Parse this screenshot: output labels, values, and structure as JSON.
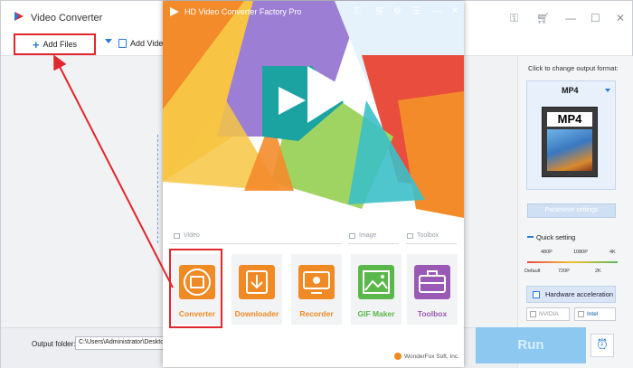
{
  "background_window": {
    "title": "Video Converter",
    "toolbar": {
      "add_files_label": "Add Files",
      "add_video_label": "Add Video"
    },
    "output_folder_label": "Output folder:",
    "output_folder_value": "C:\\Users\\Administrator\\Desktop",
    "right_panel": {
      "format_hint": "Click to change output format:",
      "format_name": "MP4",
      "format_icon_label": "MP4",
      "parameter_settings_label": "Parameter settings",
      "quick_setting_label": "Quick setting",
      "quality_ticks_top": [
        "480P",
        "1080P",
        "4K"
      ],
      "quality_ticks_bottom": [
        "Default",
        "720P",
        "2K"
      ],
      "hardware_acceleration_label": "Hardware acceleration",
      "gpu_options": [
        "NVIDIA",
        "Intel"
      ]
    },
    "run_label": "Run"
  },
  "app_window": {
    "title": "HD Video Converter Factory Pro",
    "sections": {
      "video": "Video",
      "image": "Image",
      "toolbox": "Toolbox"
    },
    "tiles": [
      {
        "label": "Converter",
        "color": "#f08a24"
      },
      {
        "label": "Downloader",
        "color": "#f08a24"
      },
      {
        "label": "Recorder",
        "color": "#f08a24"
      },
      {
        "label": "GIF Maker",
        "color": "#5ab84a"
      },
      {
        "label": "Toolbox",
        "color": "#9b59b6"
      }
    ],
    "copyright": "WonderFox Soft, Inc."
  },
  "colors": {
    "accent_blue": "#2a7ad8",
    "annotation_red": "#e1262c",
    "brand_orange": "#f08a24"
  }
}
